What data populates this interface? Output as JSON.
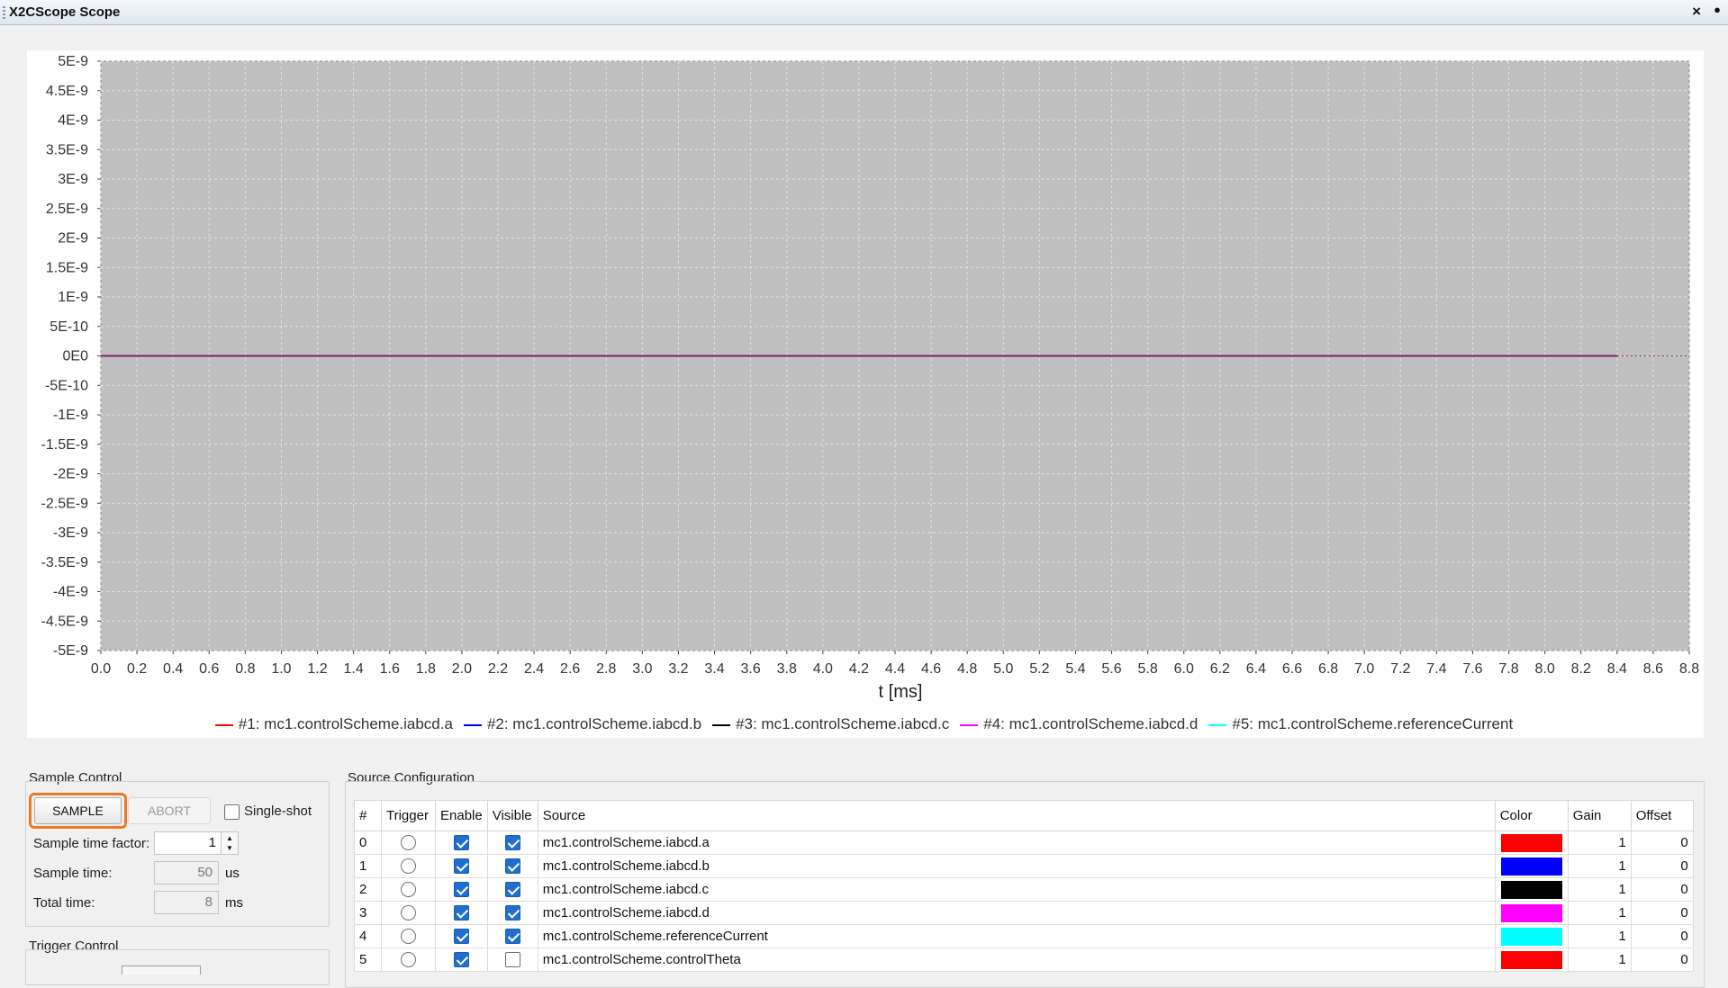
{
  "window": {
    "title": "X2CScope Scope"
  },
  "chart_data": {
    "type": "line",
    "xlabel": "t [ms]",
    "ylabel": "",
    "xlim": [
      0.0,
      8.8
    ],
    "ylim": [
      -5e-09,
      5e-09
    ],
    "yticks": [
      "5E-9",
      "4.5E-9",
      "4E-9",
      "3.5E-9",
      "3E-9",
      "2.5E-9",
      "2E-9",
      "1.5E-9",
      "1E-9",
      "5E-10",
      "0E0",
      "-5E-10",
      "-1E-9",
      "-1.5E-9",
      "-2E-9",
      "-2.5E-9",
      "-3E-9",
      "-3.5E-9",
      "-4E-9",
      "-4.5E-9",
      "-5E-9"
    ],
    "xticks": [
      "0.0",
      "0.2",
      "0.4",
      "0.6",
      "0.8",
      "1.0",
      "1.2",
      "1.4",
      "1.6",
      "1.8",
      "2.0",
      "2.2",
      "2.4",
      "2.6",
      "2.8",
      "3.0",
      "3.2",
      "3.4",
      "3.6",
      "3.8",
      "4.0",
      "4.2",
      "4.4",
      "4.6",
      "4.8",
      "5.0",
      "5.2",
      "5.4",
      "5.6",
      "5.8",
      "6.0",
      "6.2",
      "6.4",
      "6.6",
      "6.8",
      "7.0",
      "7.2",
      "7.4",
      "7.6",
      "7.8",
      "8.0",
      "8.2",
      "8.4",
      "8.6",
      "8.8"
    ],
    "grid": true,
    "legend_position": "bottom",
    "background": "#c0c0c0",
    "series": [
      {
        "name": "#1: mc1.controlScheme.iabcd.a",
        "color": "#ff0000",
        "x": [
          0.0,
          8.4
        ],
        "y": [
          0,
          0
        ]
      },
      {
        "name": "#2: mc1.controlScheme.iabcd.b",
        "color": "#0000ff",
        "x": [
          0.0,
          8.4
        ],
        "y": [
          0,
          0
        ]
      },
      {
        "name": "#3: mc1.controlScheme.iabcd.c",
        "color": "#000000",
        "x": [
          0.0,
          8.4
        ],
        "y": [
          0,
          0
        ]
      },
      {
        "name": "#4: mc1.controlScheme.iabcd.d",
        "color": "#ff00ff",
        "x": [
          0.0,
          8.4
        ],
        "y": [
          0,
          0
        ]
      },
      {
        "name": "#5: mc1.controlScheme.referenceCurrent",
        "color": "#00ffff",
        "x": [
          0.0,
          8.4
        ],
        "y": [
          0,
          0
        ]
      }
    ]
  },
  "sample_control": {
    "label": "Sample Control",
    "sample_button": "SAMPLE",
    "abort_button": "ABORT",
    "single_shot_label": "Single-shot",
    "single_shot_checked": false,
    "sample_time_factor_label": "Sample time factor:",
    "sample_time_factor_value": "1",
    "sample_time_label": "Sample time:",
    "sample_time_value": "50",
    "sample_time_unit": "us",
    "total_time_label": "Total time:",
    "total_time_value": "8",
    "total_time_unit": "ms"
  },
  "trigger_control": {
    "label": "Trigger Control"
  },
  "source_config": {
    "label": "Source Configuration",
    "columns": [
      "#",
      "Trigger",
      "Enable",
      "Visible",
      "Source",
      "Color",
      "Gain",
      "Offset"
    ],
    "rows": [
      {
        "index": "0",
        "trigger": false,
        "enable": true,
        "visible": true,
        "source": "mc1.controlScheme.iabcd.a",
        "color": "#ff0000",
        "gain": "1",
        "offset": "0"
      },
      {
        "index": "1",
        "trigger": false,
        "enable": true,
        "visible": true,
        "source": "mc1.controlScheme.iabcd.b",
        "color": "#0000ff",
        "gain": "1",
        "offset": "0"
      },
      {
        "index": "2",
        "trigger": false,
        "enable": true,
        "visible": true,
        "source": "mc1.controlScheme.iabcd.c",
        "color": "#000000",
        "gain": "1",
        "offset": "0"
      },
      {
        "index": "3",
        "trigger": false,
        "enable": true,
        "visible": true,
        "source": "mc1.controlScheme.iabcd.d",
        "color": "#ff00ff",
        "gain": "1",
        "offset": "0"
      },
      {
        "index": "4",
        "trigger": false,
        "enable": true,
        "visible": true,
        "source": "mc1.controlScheme.referenceCurrent",
        "color": "#00ffff",
        "gain": "1",
        "offset": "0"
      },
      {
        "index": "5",
        "trigger": false,
        "enable": true,
        "visible": false,
        "source": "mc1.controlScheme.controlTheta",
        "color": "#ff0000",
        "gain": "1",
        "offset": "0"
      }
    ]
  }
}
